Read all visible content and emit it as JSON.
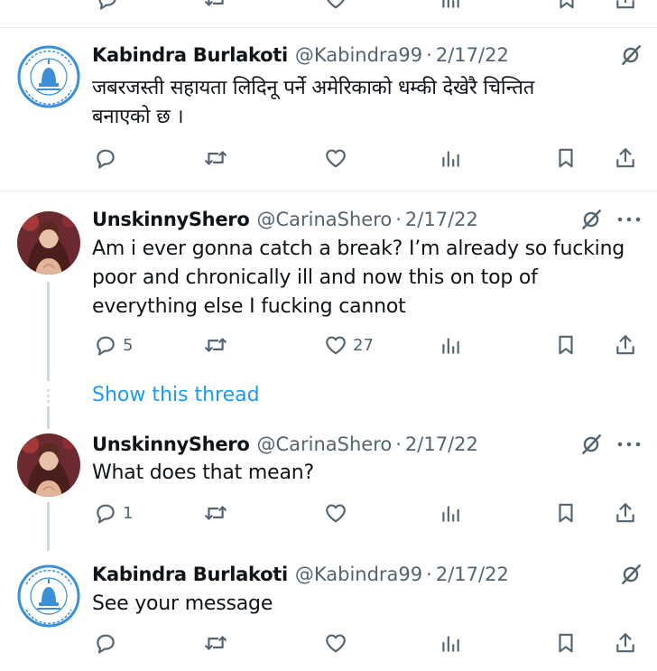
{
  "tweets": [
    {
      "author": "Kabindra Burlakoti",
      "handle": "@Kabindra99",
      "sep": "·",
      "date": "2/17/22",
      "text_lines": [
        "जबरजस्ती सहायता लिदिनू पर्ने अमेरिकाको धम्की देखेरै चिन्तित",
        "बनाएको छ ।"
      ],
      "reply_count": "",
      "like_count": "",
      "avatar": "bell-emblem"
    },
    {
      "author": "UnskinnyShero",
      "handle": "@CarinaShero",
      "sep": "·",
      "date": "2/17/22",
      "text_lines": [
        "Am i ever gonna catch a break? I’m already so fucking",
        "poor and chronically ill and now this on top of",
        "everything else I fucking cannot"
      ],
      "reply_count": "5",
      "like_count": "27",
      "avatar": "woman-portrait"
    },
    {
      "author": "UnskinnyShero",
      "handle": "@CarinaShero",
      "sep": "·",
      "date": "2/17/22",
      "text_lines": [
        "What does that mean?"
      ],
      "reply_count": "1",
      "like_count": "",
      "avatar": "woman-portrait"
    },
    {
      "author": "Kabindra Burlakoti",
      "handle": "@Kabindra99",
      "sep": "·",
      "date": "2/17/22",
      "text_lines": [
        "See your message"
      ],
      "reply_count": "",
      "like_count": "",
      "avatar": "bell-emblem"
    }
  ],
  "show_thread": "Show this thread",
  "colors": {
    "link": "#1d9bf0",
    "muted": "#536471",
    "avatar_blue": "#3a8fd6",
    "avatar_red": "#7a1d24"
  },
  "icons": [
    "reply-icon",
    "retweet-icon",
    "like-icon",
    "views-icon",
    "bookmark-icon",
    "share-icon",
    "grok-icon",
    "more-icon"
  ]
}
